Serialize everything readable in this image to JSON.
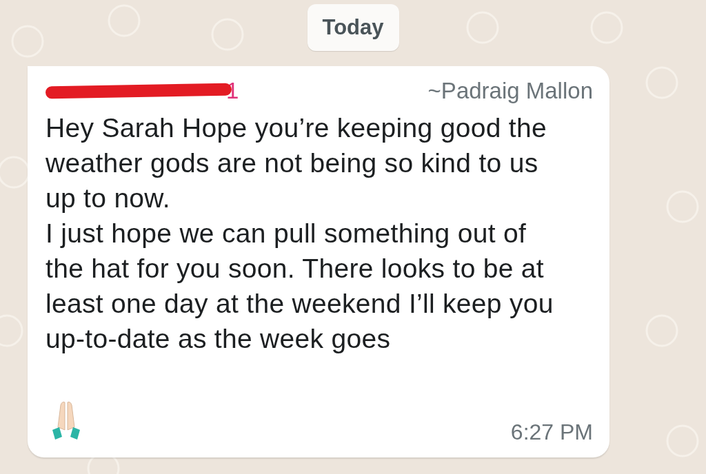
{
  "date_chip": "Today",
  "message": {
    "sender_number_visible": "1",
    "sender_name": "~Padraig Mallon",
    "lines": [
      "Hey Sarah Hope you’re keeping good the",
      "weather gods are not being so kind to us",
      "up to now.",
      "I just hope we can pull something out of",
      "the hat for you soon. There looks to be at",
      "least one day at the weekend I’ll keep you",
      "up-to-date as the week goes"
    ],
    "time": "6:27 PM"
  }
}
